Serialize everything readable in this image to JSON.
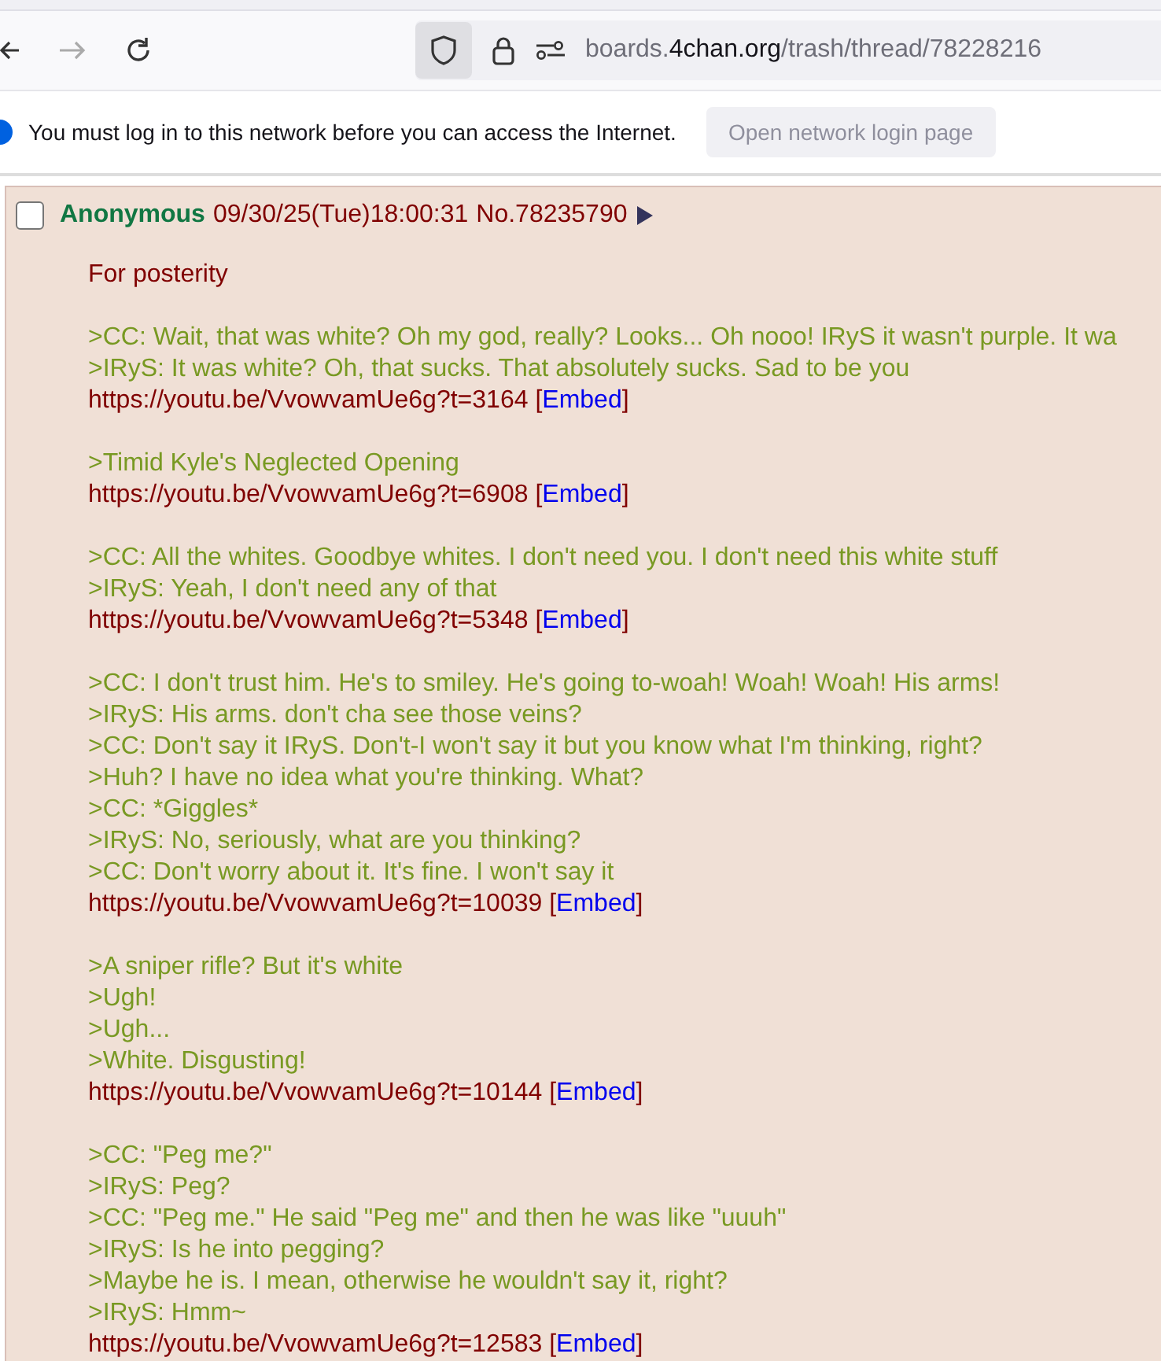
{
  "toolbar": {
    "forward_disabled": true,
    "url": {
      "subdomain": "boards.",
      "domain": "4chan.org",
      "path": "/trash/thread/78228216"
    }
  },
  "notification": {
    "message": "You must log in to this network before you can access the Internet.",
    "button": "Open network login page"
  },
  "post": {
    "checked": false,
    "name": "Anonymous",
    "datetime": "09/30/25(Tue)18:00:31",
    "number": "No.78235790",
    "brackets": [
      "[",
      "]"
    ],
    "blocks": [
      [
        {
          "kind": "text",
          "text": "For posterity"
        }
      ],
      [
        {
          "kind": "quote",
          "text": ">CC: Wait, that was white? Oh my god, really? Looks... Oh nooo! IRyS it wasn't purple. It wa"
        },
        {
          "kind": "quote",
          "text": ">IRyS: It was white? Oh, that sucks. That absolutely sucks. Sad to be you"
        },
        {
          "kind": "link",
          "text": "https://youtu.be/VvowvamUe6g?t=3164",
          "embed": "Embed"
        }
      ],
      [
        {
          "kind": "quote",
          "text": ">Timid Kyle's Neglected Opening"
        },
        {
          "kind": "link",
          "text": "https://youtu.be/VvowvamUe6g?t=6908",
          "embed": "Embed"
        }
      ],
      [
        {
          "kind": "quote",
          "text": ">CC: All the whites. Goodbye whites. I don't need you. I don't need this white stuff"
        },
        {
          "kind": "quote",
          "text": ">IRyS: Yeah, I don't need any of that"
        },
        {
          "kind": "link",
          "text": "https://youtu.be/VvowvamUe6g?t=5348",
          "embed": "Embed"
        }
      ],
      [
        {
          "kind": "quote",
          "text": ">CC: I don't trust him. He's to smiley. He's going to-woah! Woah! Woah! His arms!"
        },
        {
          "kind": "quote",
          "text": ">IRyS: His arms. don't cha see those veins?"
        },
        {
          "kind": "quote",
          "text": ">CC: Don't say it IRyS. Don't-I won't say it but you know what I'm thinking, right?"
        },
        {
          "kind": "quote",
          "text": ">Huh? I have no idea what you're thinking. What?"
        },
        {
          "kind": "quote",
          "text": ">CC: *Giggles*"
        },
        {
          "kind": "quote",
          "text": ">IRyS: No, seriously, what are you thinking?"
        },
        {
          "kind": "quote",
          "text": ">CC: Don't worry about it. It's fine. I won't say it"
        },
        {
          "kind": "link",
          "text": "https://youtu.be/VvowvamUe6g?t=10039",
          "embed": "Embed"
        }
      ],
      [
        {
          "kind": "quote",
          "text": ">A sniper rifle? But it's white"
        },
        {
          "kind": "quote",
          "text": ">Ugh!"
        },
        {
          "kind": "quote",
          "text": ">Ugh..."
        },
        {
          "kind": "quote",
          "text": ">White. Disgusting!"
        },
        {
          "kind": "link",
          "text": "https://youtu.be/VvowvamUe6g?t=10144",
          "embed": "Embed"
        }
      ],
      [
        {
          "kind": "quote",
          "text": ">CC: \"Peg me?\""
        },
        {
          "kind": "quote",
          "text": ">IRyS: Peg?"
        },
        {
          "kind": "quote",
          "text": ">CC: \"Peg me.\" He said \"Peg me\" and then he was like \"uuuh\""
        },
        {
          "kind": "quote",
          "text": ">IRyS: Is he into pegging?"
        },
        {
          "kind": "quote",
          "text": ">Maybe he is. I mean, otherwise he wouldn't say it, right?"
        },
        {
          "kind": "quote",
          "text": ">IRyS: Hmm~"
        },
        {
          "kind": "link",
          "text": "https://youtu.be/VvowvamUe6g?t=12583",
          "embed": "Embed"
        }
      ]
    ]
  }
}
